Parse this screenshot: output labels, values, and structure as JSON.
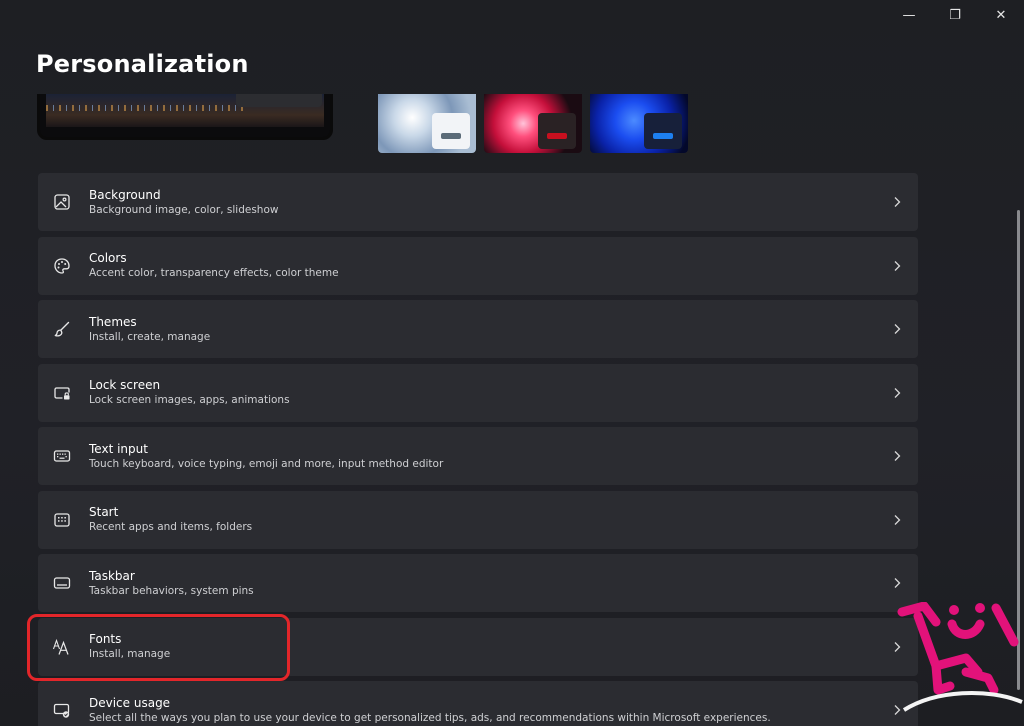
{
  "window": {
    "minimize_glyph": "—",
    "restore_glyph": "❐",
    "close_glyph": "✕"
  },
  "page": {
    "title": "Personalization"
  },
  "settings": [
    {
      "title": "Background",
      "subtitle": "Background image, color, slideshow",
      "icon": "image-icon"
    },
    {
      "title": "Colors",
      "subtitle": "Accent color, transparency effects, color theme",
      "icon": "palette-icon"
    },
    {
      "title": "Themes",
      "subtitle": "Install, create, manage",
      "icon": "brush-icon"
    },
    {
      "title": "Lock screen",
      "subtitle": "Lock screen images, apps, animations",
      "icon": "lock-screen-icon"
    },
    {
      "title": "Text input",
      "subtitle": "Touch keyboard, voice typing, emoji and more, input method editor",
      "icon": "keyboard-icon"
    },
    {
      "title": "Start",
      "subtitle": "Recent apps and items, folders",
      "icon": "start-icon"
    },
    {
      "title": "Taskbar",
      "subtitle": "Taskbar behaviors, system pins",
      "icon": "taskbar-icon"
    },
    {
      "title": "Fonts",
      "subtitle": "Install, manage",
      "icon": "fonts-icon"
    },
    {
      "title": "Device usage",
      "subtitle": "Select all the ways you plan to use your device to get personalized tips, ads, and recommendations within Microsoft experiences.",
      "icon": "device-usage-icon"
    }
  ],
  "colors": {
    "highlight": "#e3262a",
    "logo": "#e2127a",
    "row_background": "#2b2c31"
  }
}
